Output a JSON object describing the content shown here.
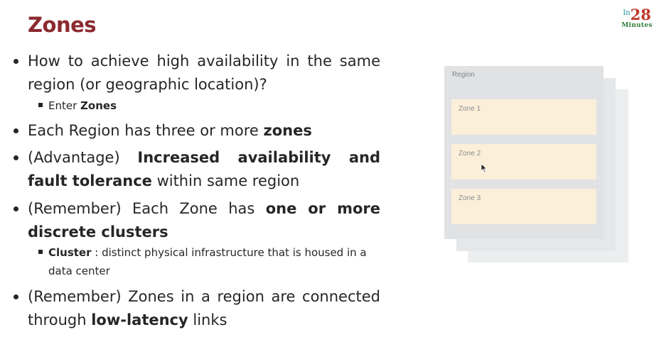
{
  "slide": {
    "title": "Zones",
    "logo": {
      "prefix": "In",
      "number": "28",
      "suffix": "Minutes"
    }
  },
  "bullets": [
    {
      "parts": [
        {
          "t": "How to achieve high availability in the same region (or geographic location)?",
          "b": false
        }
      ]
    },
    {
      "parts": [
        {
          "t": "Each Region has three or more ",
          "b": false
        },
        {
          "t": "zones",
          "b": true
        }
      ]
    },
    {
      "parts": [
        {
          "t": "(Advantage) ",
          "b": false
        },
        {
          "t": "Increased availability and fault tolerance",
          "b": true
        },
        {
          "t": " within same region",
          "b": false
        }
      ]
    },
    {
      "parts": [
        {
          "t": "(Remember) Each Zone has ",
          "b": false
        },
        {
          "t": "one or more discrete clusters",
          "b": true
        }
      ]
    },
    {
      "parts": [
        {
          "t": "(Remember) Zones in a region are connected through ",
          "b": false
        },
        {
          "t": "low-latency",
          "b": true
        },
        {
          "t": " links",
          "b": false
        }
      ]
    }
  ],
  "subbullets": [
    {
      "parts": [
        {
          "t": "Enter ",
          "b": false
        },
        {
          "t": "Zones",
          "b": true
        }
      ]
    },
    {
      "parts": [
        {
          "t": "Cluster",
          "b": true
        },
        {
          "t": " : distinct physical infrastructure that is housed in a data center",
          "b": false
        }
      ]
    }
  ],
  "diagram": {
    "region_label": "Region",
    "zones": [
      "Zone 1",
      "Zone 2",
      "Zone 3"
    ]
  }
}
